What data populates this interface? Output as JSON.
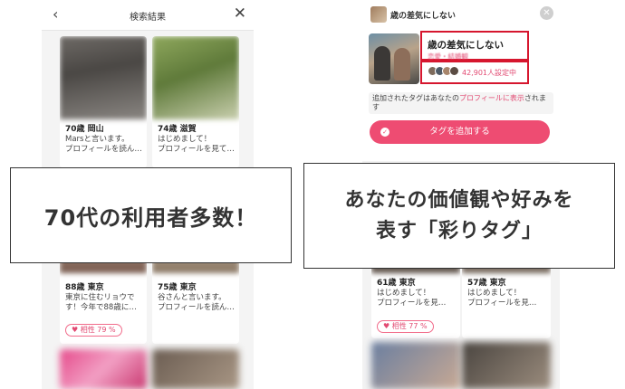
{
  "left_screen": {
    "header_title": "検索結果",
    "back_glyph": "‹",
    "close_glyph": "✕",
    "cards": [
      {
        "name": "70歳 岡山",
        "line1": "Marsと言います。",
        "line2": "プロフィールを読ん…"
      },
      {
        "name": "74歳 滋賀",
        "line1": "はじめまして！",
        "line2": "プロフィールを見て…"
      },
      {
        "name": "88歳 東京",
        "line1": "東京に住むリョウで",
        "line2": "す！今年で88歳に…",
        "match": "相性 79 %"
      },
      {
        "name": "75歳 東京",
        "line1": "谷さんと言います。",
        "line2": "プロフィールを読ん…"
      }
    ]
  },
  "right_screen": {
    "sheet_title": "歳の差気にしない",
    "tag_title": "歳の差気にしない",
    "tag_category": "恋愛・結婚観",
    "set_count": "42,901人設定中",
    "note_prefix": "追加されたタグはあなたの",
    "note_link": "プロフィールに表示",
    "note_suffix": "されます",
    "add_button": "タグを追加する",
    "close_glyph": "✕",
    "check_glyph": "✓",
    "cards": [
      {
        "name": "61歳 東京",
        "line1": "はじめまして！",
        "line2": "プロフィールを見…",
        "match": "相性 77 %"
      },
      {
        "name": "57歳 東京",
        "line1": "はじめまして！",
        "line2": "プロフィールを見…"
      }
    ]
  },
  "captions": {
    "left": "70代の利用者多数！",
    "right_line1": "あなたの価値観や好みを",
    "right_line2": "表す「彩りタグ」"
  },
  "colors": {
    "accent": "#ee4c72",
    "highlight": "#d6162e"
  }
}
